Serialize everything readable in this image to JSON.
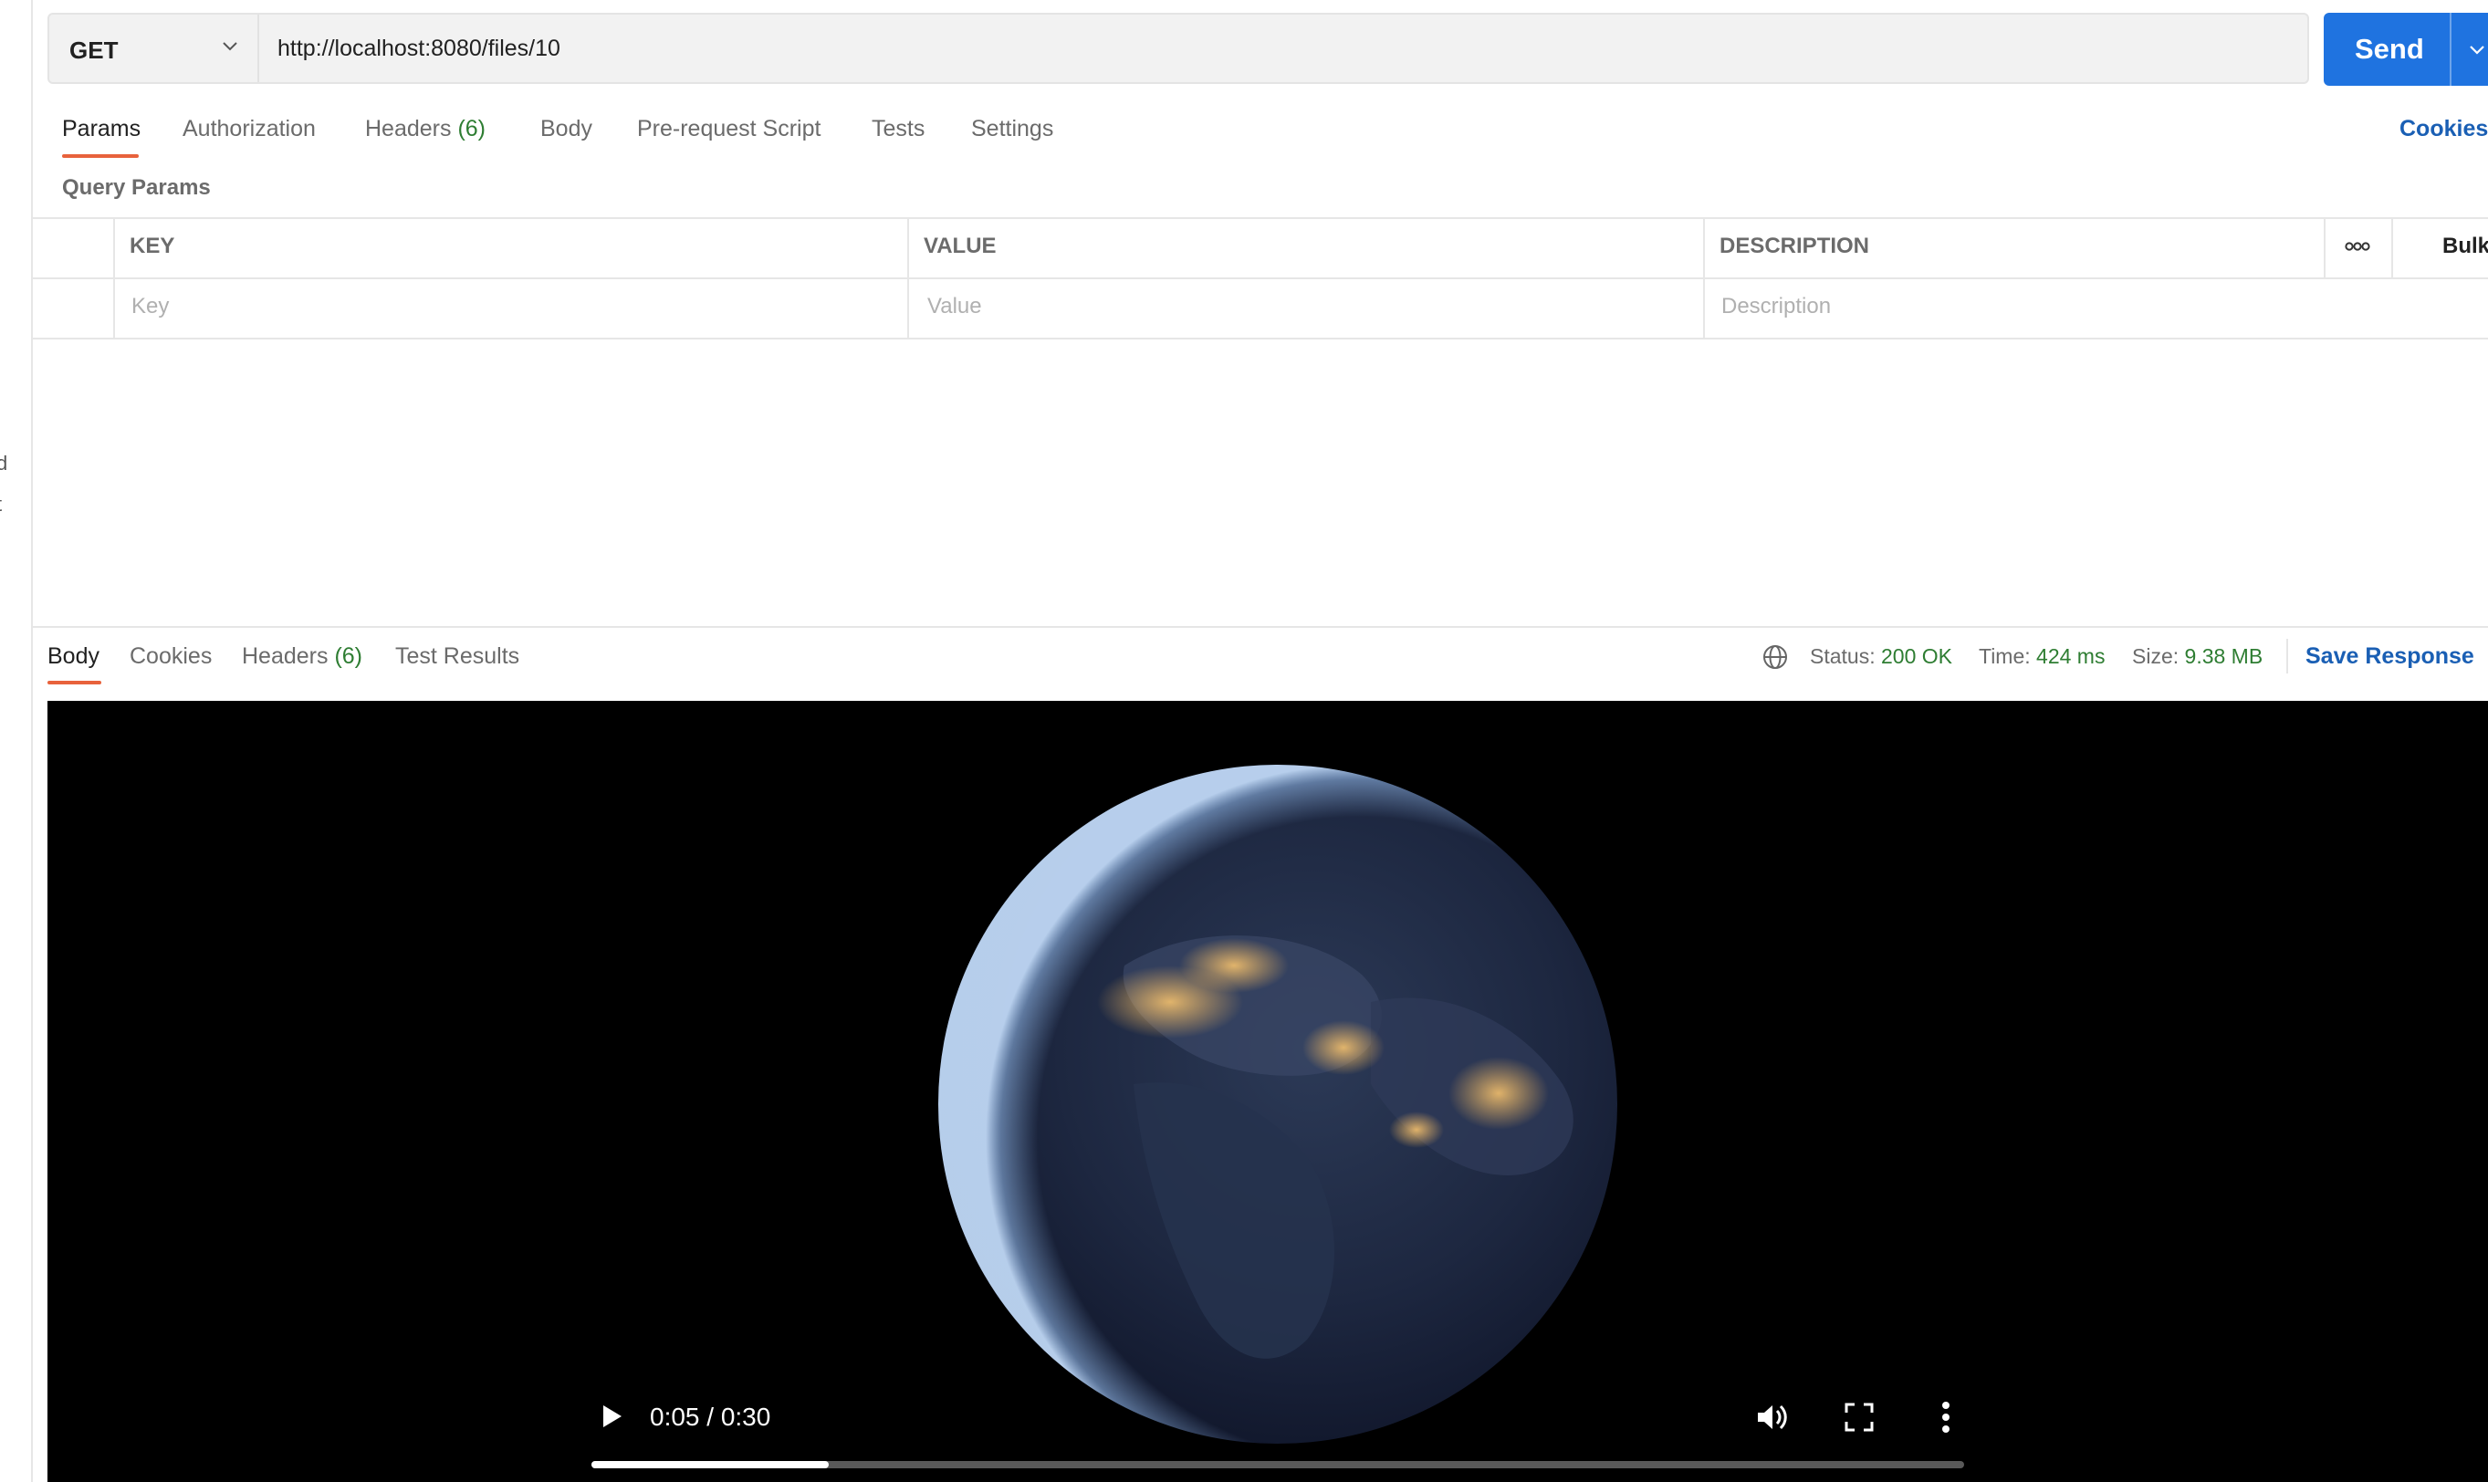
{
  "sidebar": {
    "fragments": [
      "d",
      "t"
    ]
  },
  "request": {
    "method": "GET",
    "url": "http://localhost:8080/files/10",
    "send_label": "Send"
  },
  "request_tabs": {
    "params": "Params",
    "authorization": "Authorization",
    "headers": "Headers",
    "headers_count": "(6)",
    "body": "Body",
    "prerequest": "Pre-request Script",
    "tests": "Tests",
    "settings": "Settings",
    "cookies": "Cookies"
  },
  "query_params": {
    "title": "Query Params",
    "columns": {
      "key": "KEY",
      "value": "VALUE",
      "description": "DESCRIPTION"
    },
    "placeholders": {
      "key": "Key",
      "value": "Value",
      "description": "Description"
    },
    "more_icon": "more-horizontal-icon",
    "bulk_edit": "Bulk Ed"
  },
  "response_tabs": {
    "body": "Body",
    "cookies": "Cookies",
    "headers": "Headers",
    "headers_count": "(6)",
    "test_results": "Test Results"
  },
  "response_meta": {
    "status_label": "Status:",
    "status_value": "200 OK",
    "time_label": "Time:",
    "time_value": "424 ms",
    "size_label": "Size:",
    "size_value": "9.38 MB",
    "save_response": "Save Response"
  },
  "video": {
    "time": "0:05 / 0:30",
    "progress": 0.1727
  },
  "colors": {
    "accent": "#1f73e0",
    "tab_underline": "#e8623c",
    "success": "#2e7d32",
    "link": "#1a5fb4"
  }
}
